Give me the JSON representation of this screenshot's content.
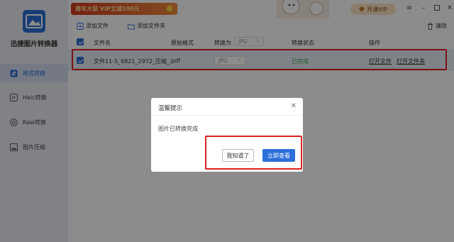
{
  "app": {
    "name": "迅捷图片转换器"
  },
  "sidebar": {
    "items": [
      {
        "label": "格式转换",
        "icon": "format-convert-icon",
        "active": true
      },
      {
        "label": "Heic转换",
        "icon": "heic-icon",
        "active": false
      },
      {
        "label": "Raw转换",
        "icon": "raw-icon",
        "active": false
      },
      {
        "label": "图片压缩",
        "icon": "image-compress-icon",
        "active": false
      }
    ]
  },
  "topbar": {
    "promo_text": "周年大促 VIP立减100元",
    "vip_label": "开通VIP",
    "controls": [
      "menu-icon",
      "minimize-icon",
      "maximize-icon",
      "close-icon"
    ]
  },
  "toolbar": {
    "add_file": "添加文件",
    "add_folder": "添加文件夹",
    "clear": "清除"
  },
  "table": {
    "headers": {
      "filename": "文件名",
      "original_format": "原始格式",
      "convert_to": "转换为",
      "convert_to_value": "JPG",
      "status": "转换状态",
      "actions": "操作"
    },
    "rows": [
      {
        "filename": "文件11-5_6821_2972_压缩_...",
        "original_format": "pdf",
        "convert_to": "JPG",
        "status": "已完成",
        "open_file": "打开文件",
        "open_folder": "打开文件夹"
      }
    ]
  },
  "modal": {
    "title": "温馨提示",
    "message": "图片已转换完成",
    "secondary_button": "我知道了",
    "primary_button": "立即查看"
  },
  "colors": {
    "accent": "#2c6fd8",
    "status_success": "#3aa54a",
    "highlight_border": "#e02020",
    "sidebar_bg": "#e9edf5"
  }
}
